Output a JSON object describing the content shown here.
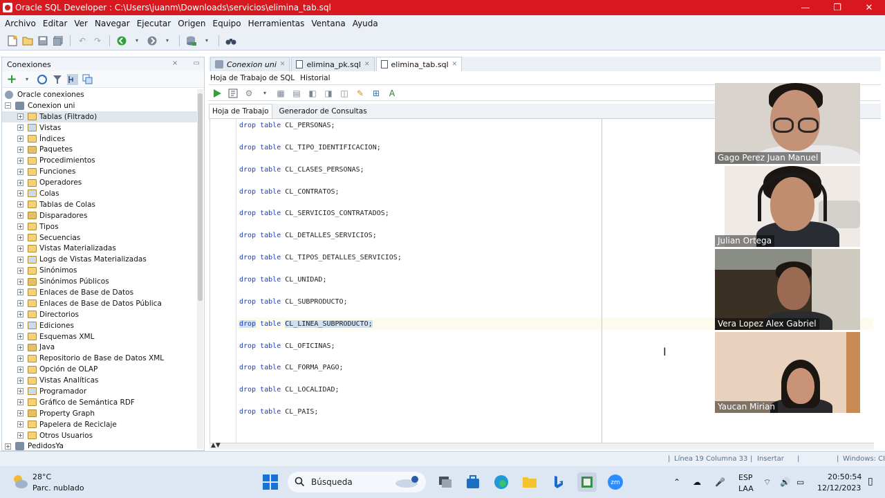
{
  "window": {
    "title": "Oracle SQL Developer : C:\\Users\\juanm\\Downloads\\servicios\\elimina_tab.sql",
    "controls": [
      "—",
      "❐",
      "✕"
    ]
  },
  "menu": [
    "Archivo",
    "Editar",
    "Ver",
    "Navegar",
    "Ejecutar",
    "Origen",
    "Equipo",
    "Herramientas",
    "Ventana",
    "Ayuda"
  ],
  "connections_panel": {
    "title": "Conexiones",
    "root": "Oracle conexiones",
    "connection": "Conexion uni",
    "items": [
      "Tablas (Filtrado)",
      "Vistas",
      "Índices",
      "Paquetes",
      "Procedimientos",
      "Funciones",
      "Operadores",
      "Colas",
      "Tablas de Colas",
      "Disparadores",
      "Tipos",
      "Secuencias",
      "Vistas Materializadas",
      "Logs de Vistas Materializadas",
      "Sinónimos",
      "Sinónimos Públicos",
      "Enlaces de Base de Datos",
      "Enlaces de Base de Datos Pública",
      "Directorios",
      "Ediciones",
      "Esquemas XML",
      "Java",
      "Repositorio de Base de Datos XML",
      "Opción de OLAP",
      "Vistas Analíticas",
      "Programador",
      "Gráfico de Semántica RDF",
      "Property Graph",
      "Papelera de Reciclaje",
      "Otros Usuarios"
    ],
    "next_connection": "PedidosYa"
  },
  "editor_tabs": [
    {
      "label": "Conexion uni",
      "active": false
    },
    {
      "label": "elimina_pk.sql",
      "active": false
    },
    {
      "label": "elimina_tab.sql",
      "active": true
    }
  ],
  "sub_tabs": [
    "Hoja de Trabajo de SQL",
    "Historial"
  ],
  "work_tabs": [
    "Hoja de Trabajo",
    "Generador de Consultas"
  ],
  "code": {
    "keyword_drop": "drop",
    "keyword_table": "table",
    "lines": [
      "CL_PERSONAS;",
      "CL_TIPO_IDENTIFICACION;",
      "CL_CLASES_PERSONAS;",
      "CL_CONTRATOS;",
      "CL_SERVICIOS_CONTRATADOS;",
      "CL_DETALLES_SERVICIOS;",
      "CL_TIPOS_DETALLES_SERVICIOS;",
      "CL_UNIDAD;",
      "CL_SUBPRODUCTO;",
      "CL_LINEA_SUBPRODUCTO;",
      "CL_OFICINAS;",
      "CL_FORMA_PAGO;",
      "CL_LOCALIDAD;",
      "CL_PAIS;"
    ]
  },
  "status": {
    "position": "Línea 19 Columna 33",
    "mode": "Insertar",
    "line_endings": "Windows: CI"
  },
  "participants": [
    "Gago Perez Juan Manuel",
    "Julian Ortega",
    "Vera Lopez Alex Gabriel",
    "Yaucan Mirian"
  ],
  "taskbar": {
    "weather_temp": "28°C",
    "weather_desc": "Parc. nublado",
    "search_label": "Búsqueda",
    "lang_top": "ESP",
    "lang_bottom": "LAA",
    "time": "20:50:54",
    "date": "12/12/2023"
  },
  "colors": {
    "titlebar": "#d7191f",
    "accent": "#1d3fb0",
    "taskbar": "#dde6f3"
  }
}
